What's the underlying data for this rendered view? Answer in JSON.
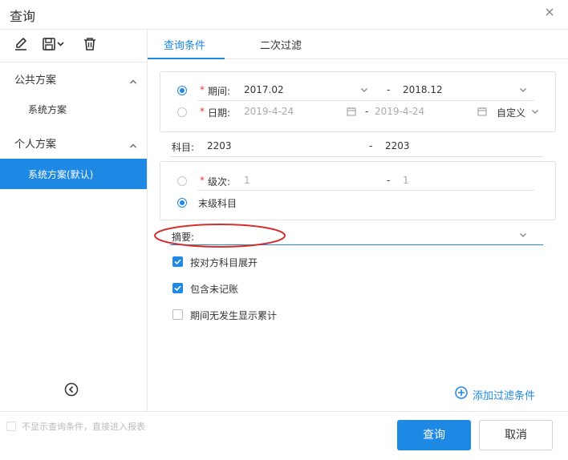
{
  "window": {
    "title": "查询"
  },
  "toolbar": {
    "tools": [
      "edit-icon",
      "save-icon",
      "delete-icon"
    ]
  },
  "sidebar": {
    "groups": [
      {
        "label": "公共方案",
        "items": [
          {
            "label": "系统方案",
            "selected": false
          }
        ]
      },
      {
        "label": "个人方案",
        "items": [
          {
            "label": "系统方案(默认)",
            "selected": true
          }
        ]
      }
    ]
  },
  "tabs": [
    {
      "label": "查询条件",
      "active": true
    },
    {
      "label": "二次过滤",
      "active": false
    }
  ],
  "form": {
    "period": {
      "required_mark": "*",
      "label": "期间:",
      "from": "2017.02",
      "separator": "-",
      "to": "2018.12",
      "selected": true
    },
    "date": {
      "required_mark": "*",
      "label": "日期:",
      "from": "2019-4-24",
      "separator": "-",
      "to": "2019-4-24",
      "mode": "自定义",
      "selected": false
    },
    "account": {
      "label": "科目:",
      "from": "2203",
      "separator": "-",
      "to": "2203"
    },
    "level": {
      "required_mark": "*",
      "label": "级次:",
      "from": "1",
      "separator": "-",
      "to": "1",
      "selected": false
    },
    "leaf_account": {
      "label": "末级科目",
      "selected": true
    },
    "summary": {
      "label": "摘要:",
      "value": ""
    },
    "options": [
      {
        "label": "按对方科目展开",
        "checked": true
      },
      {
        "label": "包含未记账",
        "checked": true
      },
      {
        "label": "期间无发生显示累计",
        "checked": false
      }
    ],
    "add_filter_label": "添加过滤条件"
  },
  "footer": {
    "skip_note": "不显示查询条件，直接进入报表",
    "query_label": "查询",
    "cancel_label": "取消"
  },
  "colors": {
    "accent": "#1e88e5",
    "required": "#e53935",
    "annotation": "#d32f2f"
  }
}
